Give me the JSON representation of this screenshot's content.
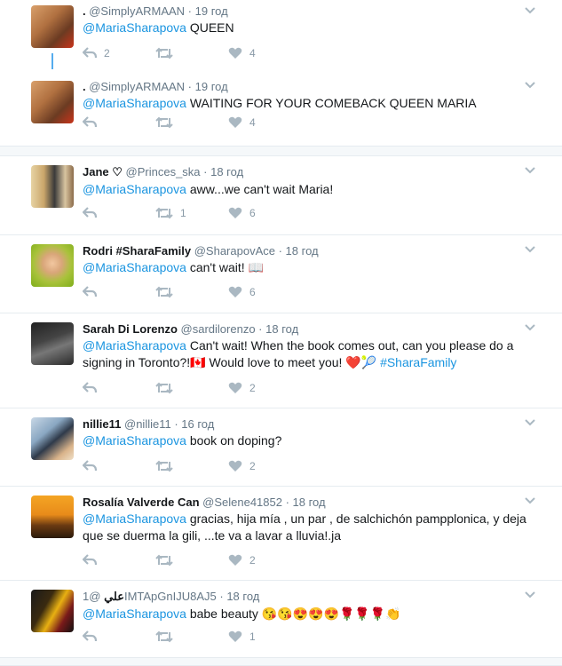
{
  "tweets": [
    {
      "name": ". ",
      "handle": "@SimplyARMAAN",
      "time": "19 год",
      "mention": "@MariaSharapova",
      "text": " QUEEN",
      "reply": "2",
      "retweet": "",
      "like": "4"
    },
    {
      "name": ". ",
      "handle": "@SimplyARMAAN",
      "time": "19 год",
      "mention": "@MariaSharapova",
      "text": " WAITING FOR YOUR COMEBACK QUEEN MARIA",
      "reply": "",
      "retweet": "",
      "like": "4"
    },
    {
      "name": "Jane ♡",
      "handle": "@Princes_ska",
      "time": "18 год",
      "mention": "@MariaSharapova",
      "text": " aww...we can't wait Maria!",
      "reply": "",
      "retweet": "1",
      "like": "6"
    },
    {
      "name": "Rodri #SharaFamily",
      "handle": "@SharapovAce",
      "time": "18 год",
      "mention": "@MariaSharapova",
      "text": " can't wait! 📖",
      "reply": "",
      "retweet": "",
      "like": "6"
    },
    {
      "name": "Sarah Di Lorenzo",
      "handle": "@sardilorenzo",
      "time": "18 год",
      "mention": "@MariaSharapova",
      "text": " Can't wait! When the book comes out, can you please do a signing in Toronto?!🇨🇦 Would love to meet you! ❤️🎾 ",
      "hashtag": "#SharaFamily",
      "reply": "",
      "retweet": "",
      "like": "2"
    },
    {
      "name": "nillie11",
      "handle": "@nillie11",
      "time": "16 год",
      "mention": "@MariaSharapova",
      "text": " book on doping?",
      "reply": "",
      "retweet": "",
      "like": "2"
    },
    {
      "name": "Rosalía Valverde Can",
      "handle": "@Selene41852",
      "time": "18 год",
      "mention": "@MariaSharapova",
      "text": " gracias, hija mía , un par , de salchichón pampplonica, y deja que se duerma la gili, ...te va a lavar a lluvia!.ja",
      "reply": "",
      "retweet": "",
      "like": "2"
    },
    {
      "name": "علي",
      "handle": "@1IMTApGnIJU8AJ5",
      "time": "18 год",
      "mention": "@MariaSharapova",
      "text": " babe beauty 😘😘😍😍😍🌹🌹🌹👏",
      "reply": "",
      "retweet": "",
      "like": "1"
    }
  ],
  "sep": " · ",
  "colors": {
    "accent": "#1b95e0",
    "thread": "#55acee",
    "icon": "#aab8c2"
  }
}
